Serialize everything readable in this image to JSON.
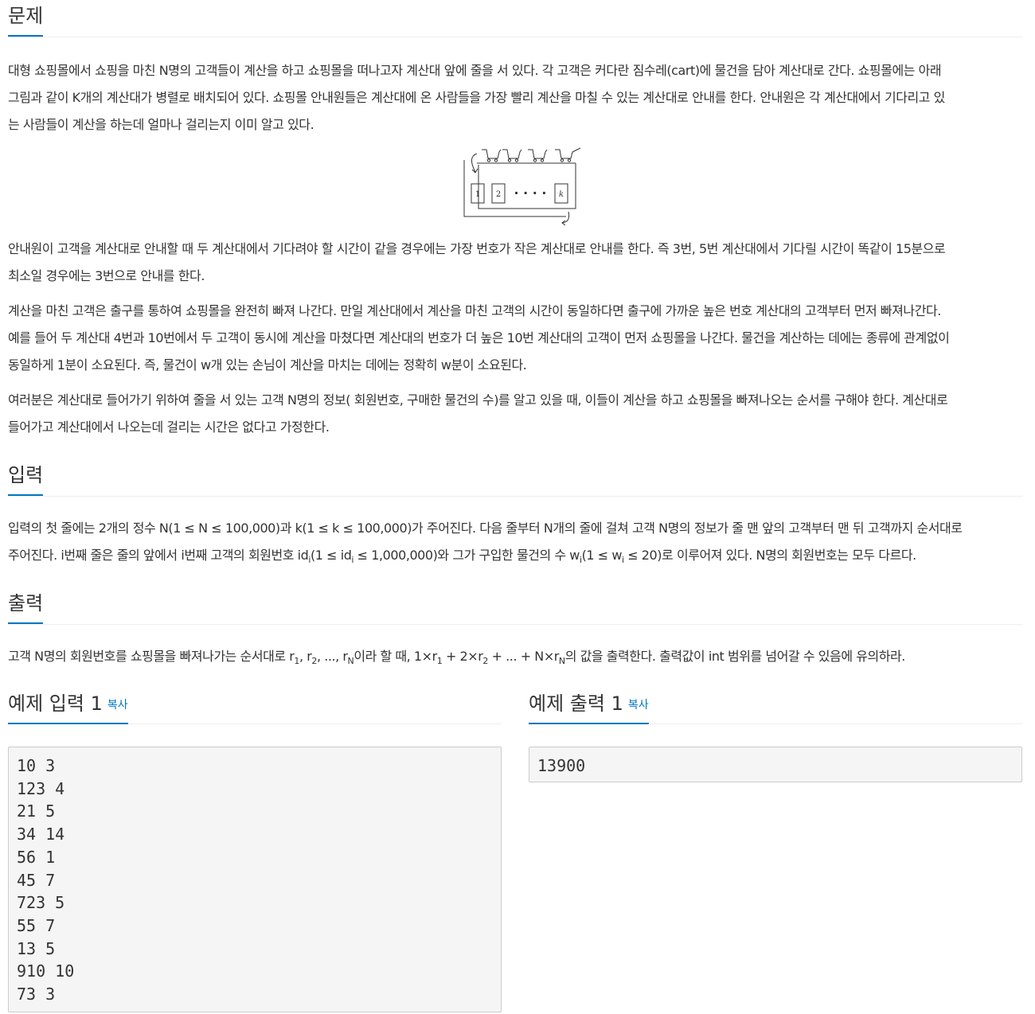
{
  "sections": {
    "problem": "문제",
    "input": "입력",
    "output": "출력"
  },
  "problem": {
    "p1": [
      "대형 쇼핑몰에서 쇼핑을 마친 N명의 고객들이 계산을 하고 쇼핑몰을 떠나고자 계산대 앞에 줄을 서 있다. 각 고객은 커다란 짐수레(cart)에 물건을 담아 계산대로 간다. 쇼핑몰에는 아래",
      "그림과 같이 K개의 계산대가 병렬로 배치되어 있다.  쇼핑몰 안내원들은 계산대에 온 사람들을 가장 빨리 계산을 마칠 수 있는 계산대로 안내를 한다. 안내원은 각 계산대에서 기다리고 있",
      "는 사람들이 계산을 하는데 얼마나 걸리는지 이미 알고 있다."
    ],
    "figure": {
      "counter_1": "1",
      "counter_2": "2",
      "dots": "· · · ·",
      "counter_k": "k"
    },
    "p2": [
      "안내원이 고객을 계산대로 안내할 때 두 계산대에서 기다려야 할 시간이 같을 경우에는 가장 번호가 작은 계산대로 안내를 한다. 즉 3번, 5번 계산대에서 기다릴 시간이 똑같이 15분으로",
      "최소일 경우에는 3번으로 안내를 한다."
    ],
    "p3": [
      "계산을 마친 고객은 출구를 통하여 쇼핑몰을 완전히 빠져 나간다. 만일 계산대에서 계산을 마친 고객의 시간이 동일하다면 출구에 가까운 높은 번호 계산대의 고객부터 먼저 빠져나간다.",
      "예를 들어 두 계산대 4번과 10번에서 두 고객이 동시에 계산을 마쳤다면 계산대의 번호가 더 높은 10번 계산대의 고객이 먼저 쇼핑몰을 나간다. 물건을 계산하는 데에는 종류에 관계없이",
      "동일하게 1분이 소요된다. 즉, 물건이 w개 있는 손님이 계산을 마치는 데에는 정확히 w분이 소요된다."
    ],
    "p4": [
      "여러분은 계산대로 들어가기 위하여 줄을 서 있는 고객 N명의 정보( 회원번호, 구매한 물건의 수)를 알고 있을 때, 이들이 계산을 하고 쇼핑몰을 빠져나오는 순서를 구해야 한다. 계산대로",
      "들어가고 계산대에서 나오는데 걸리는 시간은 없다고 가정한다."
    ]
  },
  "input": {
    "line1": "입력의 첫 줄에는 2개의 정수 N(1 ≤ N ≤ 100,000)과 k(1 ≤ k ≤ 100,000)가 주어진다. 다음 줄부터 N개의 줄에 걸쳐 고객 N명의 정보가 줄 맨 앞의 고객부터 맨 뒤 고객까지 순서대로",
    "line2_a": "주어진다. i번째 줄은 줄의 앞에서 i번째 고객의 회원번호 id",
    "line2_sub1": "i",
    "line2_b": "(1 ≤ id",
    "line2_sub2": "i",
    "line2_c": " ≤ 1,000,000)와 그가 구입한 물건의 수 w",
    "line2_sub3": "i",
    "line2_d": "(1 ≤ w",
    "line2_sub4": "i",
    "line2_e": " ≤ 20)로 이루어져 있다. N명의 회원번호는 모두 다르다."
  },
  "output": {
    "a": "고객 N명의 회원번호를 쇼핑몰을 빠져나가는 순서대로 r",
    "s1": "1",
    "b": ", r",
    "s2": "2",
    "c": ", ..., r",
    "s3": "N",
    "d": "이라 할 때, 1×r",
    "s4": "1",
    "e": " + 2×r",
    "s5": "2",
    "f": " + ... + N×r",
    "s6": "N",
    "g": "의 값을 출력한다. 출력값이 int 범위를 넘어갈 수 있음에 유의하라."
  },
  "samples": {
    "input_title": "예제 입력 1",
    "output_title": "예제 출력 1",
    "copy_label": "복사",
    "input_text": "10 3\n123 4\n21 5\n34 14\n56 1\n45 7\n723 5\n55 7\n13 5\n910 10\n73 3",
    "output_text": "13900"
  }
}
